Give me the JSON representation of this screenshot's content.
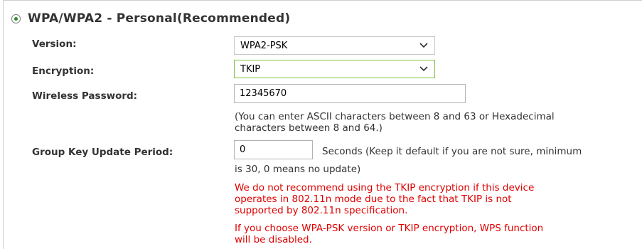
{
  "section": {
    "title": "WPA/WPA2 - Personal(Recommended)",
    "selected": true
  },
  "fields": {
    "version": {
      "label": "Version:",
      "value": "WPA2-PSK"
    },
    "encryption": {
      "label": "Encryption:",
      "value": "TKIP"
    },
    "password": {
      "label": "Wireless Password:",
      "value": "12345670",
      "hint_line1": "(You can enter ASCII characters between 8 and 63 or Hexadecimal",
      "hint_line2": "characters between 8 and 64.)"
    },
    "group_key": {
      "label": "Group Key Update Period:",
      "value": "0",
      "unit_hint": "Seconds (Keep it default if you are not sure, minimum",
      "unit_hint_line2": "is 30, 0 means no update)"
    }
  },
  "warnings": {
    "tkip_line1": "We do not recommend using the TKIP encryption if this device",
    "tkip_line2": "operates in 802.11n mode due to the fact that TKIP is not",
    "tkip_line3": "supported by 802.11n specification.",
    "wps_line1": "If you choose WPA-PSK version or TKIP encryption, WPS function",
    "wps_line2": "will be disabled."
  },
  "icons": {
    "radio": "radio-selected-icon",
    "dropdown": "chevron-down-icon"
  },
  "colors": {
    "warning": "#e00000",
    "focus_border": "#7fbf3f",
    "radio_dot": "#2a8a2a"
  }
}
